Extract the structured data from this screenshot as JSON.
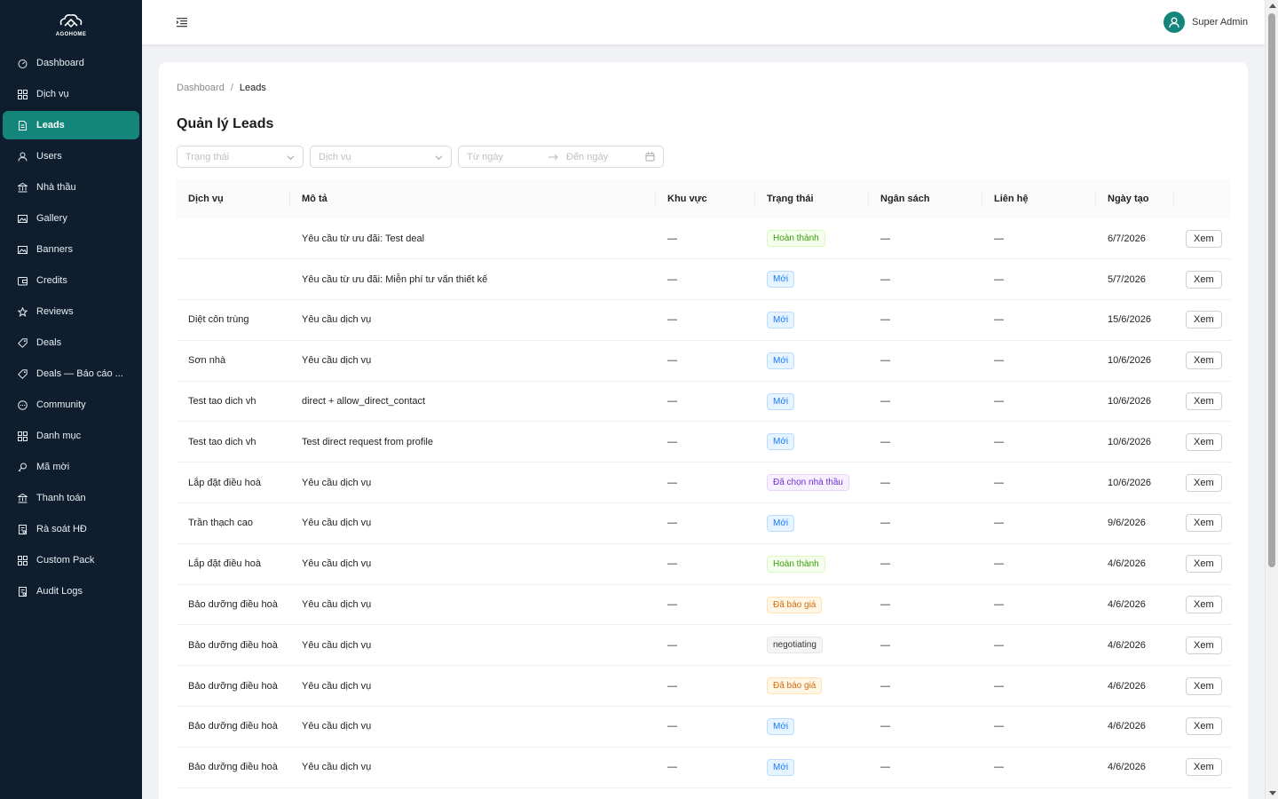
{
  "brand": {
    "name": "AGOHOME"
  },
  "sidebar": {
    "items": [
      {
        "label": "Dashboard",
        "icon": "dashboard-icon",
        "active": false
      },
      {
        "label": "Dịch vụ",
        "icon": "appstore-icon",
        "active": false
      },
      {
        "label": "Leads",
        "icon": "file-text-icon",
        "active": true
      },
      {
        "label": "Users",
        "icon": "user-icon",
        "active": false
      },
      {
        "label": "Nhà thầu",
        "icon": "bank-icon",
        "active": false
      },
      {
        "label": "Gallery",
        "icon": "picture-icon",
        "active": false
      },
      {
        "label": "Banners",
        "icon": "picture-icon",
        "active": false
      },
      {
        "label": "Credits",
        "icon": "wallet-icon",
        "active": false
      },
      {
        "label": "Reviews",
        "icon": "star-icon",
        "active": false
      },
      {
        "label": "Deals",
        "icon": "tag-icon",
        "active": false
      },
      {
        "label": "Deals — Báo cáo ...",
        "icon": "tag-icon",
        "active": false
      },
      {
        "label": "Community",
        "icon": "message-icon",
        "active": false
      },
      {
        "label": "Danh mục",
        "icon": "appstore-icon",
        "active": false
      },
      {
        "label": "Mã mời",
        "icon": "key-icon",
        "active": false
      },
      {
        "label": "Thanh toán",
        "icon": "bank-icon",
        "active": false
      },
      {
        "label": "Rà soát HĐ",
        "icon": "audit-icon",
        "active": false
      },
      {
        "label": "Custom Pack",
        "icon": "appstore-icon",
        "active": false
      },
      {
        "label": "Audit Logs",
        "icon": "audit-icon",
        "active": false
      }
    ]
  },
  "header": {
    "user_name": "Super Admin"
  },
  "breadcrumb": {
    "root": "Dashboard",
    "separator": "/",
    "current": "Leads"
  },
  "page": {
    "title": "Quản lý Leads"
  },
  "filters": {
    "status_placeholder": "Trạng thái",
    "service_placeholder": "Dịch vụ",
    "from_placeholder": "Từ ngày",
    "to_placeholder": "Đến ngày"
  },
  "table": {
    "columns": [
      "Dịch vụ",
      "Mô tả",
      "Khu vực",
      "Trạng thái",
      "Ngân sách",
      "Liên hệ",
      "Ngày tạo",
      ""
    ],
    "rows": [
      {
        "service": "",
        "desc": "Yêu cầu từ ưu đãi: Test deal",
        "area": "—",
        "status": "Hoàn thành",
        "status_kind": "done",
        "budget": "—",
        "contact": "—",
        "date": "6/7/2026",
        "action": "Xem"
      },
      {
        "service": "",
        "desc": "Yêu cầu từ ưu đãi: Miễn phí tư vấn thiết kế",
        "area": "—",
        "status": "Mới",
        "status_kind": "new",
        "budget": "—",
        "contact": "—",
        "date": "5/7/2026",
        "action": "Xem"
      },
      {
        "service": "Diệt côn trùng",
        "desc": "Yêu cầu dịch vụ",
        "area": "—",
        "status": "Mới",
        "status_kind": "new",
        "budget": "—",
        "contact": "—",
        "date": "15/6/2026",
        "action": "Xem"
      },
      {
        "service": "Sơn nhà",
        "desc": "Yêu cầu dịch vụ",
        "area": "—",
        "status": "Mới",
        "status_kind": "new",
        "budget": "—",
        "contact": "—",
        "date": "10/6/2026",
        "action": "Xem"
      },
      {
        "service": "Test tao dich vh",
        "desc": "direct + allow_direct_contact",
        "area": "—",
        "status": "Mới",
        "status_kind": "new",
        "budget": "—",
        "contact": "—",
        "date": "10/6/2026",
        "action": "Xem"
      },
      {
        "service": "Test tao dich vh",
        "desc": "Test direct request from profile",
        "area": "—",
        "status": "Mới",
        "status_kind": "new",
        "budget": "—",
        "contact": "—",
        "date": "10/6/2026",
        "action": "Xem"
      },
      {
        "service": "Lắp đặt điều hoà",
        "desc": "Yêu cầu dịch vụ",
        "area": "—",
        "status": "Đã chọn nhà thầu",
        "status_kind": "chosen",
        "budget": "—",
        "contact": "—",
        "date": "10/6/2026",
        "action": "Xem"
      },
      {
        "service": "Trần thạch cao",
        "desc": "Yêu cầu dịch vụ",
        "area": "—",
        "status": "Mới",
        "status_kind": "new",
        "budget": "—",
        "contact": "—",
        "date": "9/6/2026",
        "action": "Xem"
      },
      {
        "service": "Lắp đặt điều hoà",
        "desc": "Yêu cầu dịch vụ",
        "area": "—",
        "status": "Hoàn thành",
        "status_kind": "done",
        "budget": "—",
        "contact": "—",
        "date": "4/6/2026",
        "action": "Xem"
      },
      {
        "service": "Bảo dưỡng điều hoà",
        "desc": "Yêu cầu dịch vụ",
        "area": "—",
        "status": "Đã báo giá",
        "status_kind": "quoted",
        "budget": "—",
        "contact": "—",
        "date": "4/6/2026",
        "action": "Xem"
      },
      {
        "service": "Bảo dưỡng điều hoà",
        "desc": "Yêu cầu dịch vụ",
        "area": "—",
        "status": "negotiating",
        "status_kind": "neutral",
        "budget": "—",
        "contact": "—",
        "date": "4/6/2026",
        "action": "Xem"
      },
      {
        "service": "Bảo dưỡng điều hoà",
        "desc": "Yêu cầu dịch vụ",
        "area": "—",
        "status": "Đã báo giá",
        "status_kind": "quoted",
        "budget": "—",
        "contact": "—",
        "date": "4/6/2026",
        "action": "Xem"
      },
      {
        "service": "Bảo dưỡng điều hoà",
        "desc": "Yêu cầu dịch vụ",
        "area": "—",
        "status": "Mới",
        "status_kind": "new",
        "budget": "—",
        "contact": "—",
        "date": "4/6/2026",
        "action": "Xem"
      },
      {
        "service": "Bảo dưỡng điều hoà",
        "desc": "Yêu cầu dịch vụ",
        "area": "—",
        "status": "Mới",
        "status_kind": "new",
        "budget": "—",
        "contact": "—",
        "date": "4/6/2026",
        "action": "Xem"
      }
    ]
  },
  "colors": {
    "sidebar_bg": "#0e1e2e",
    "accent": "#14857a",
    "status": {
      "new": {
        "bg": "#e6f4ff",
        "fg": "#1677ff",
        "border": "#bcdcff"
      },
      "done": {
        "bg": "#f6ffed",
        "fg": "#389e0d",
        "border": "#d9f7be"
      },
      "quoted": {
        "bg": "#fff7e6",
        "fg": "#d46b08",
        "border": "#ffe1b3"
      },
      "chosen": {
        "bg": "#f9f0ff",
        "fg": "#722ed1",
        "border": "#e8d4fb"
      },
      "neutral": {
        "bg": "#f5f5f5",
        "fg": "#333333",
        "border": "#e5e5e5"
      }
    }
  }
}
